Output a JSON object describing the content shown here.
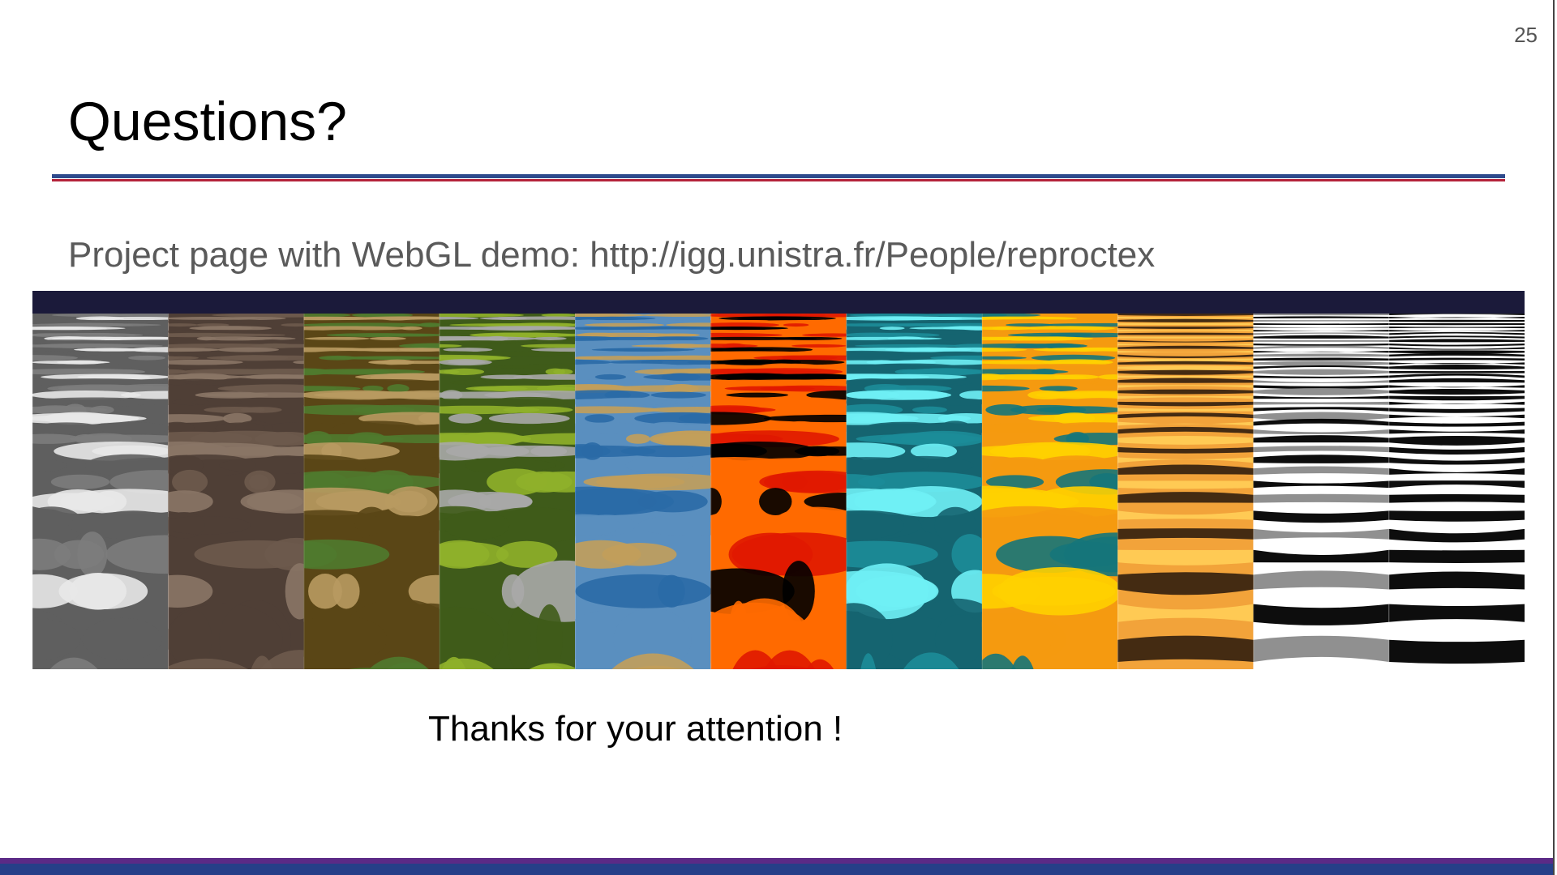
{
  "slide": {
    "page_number": "25",
    "title": "Questions?",
    "subtitle": "Project page with WebGL demo: http://igg.unistra.fr/People/reproctex",
    "closing": "Thanks for your attention !"
  },
  "colors": {
    "title_rule_blue": "#2e4a8c",
    "title_rule_red": "#b4233a",
    "footer_purple": "#5b2a86",
    "footer_blue": "#263f88",
    "strip_sky": "#1b1a3a"
  },
  "texture_panels": [
    {
      "name": "texture-panel-gray-water",
      "base": "#5f5f5f",
      "mid": "#7c7c7c",
      "light": "#e8e8e8"
    },
    {
      "name": "texture-panel-brown-rock",
      "base": "#4f3f36",
      "mid": "#6d5a4d",
      "light": "#8a7566"
    },
    {
      "name": "texture-panel-camouflage",
      "base": "#5a4616",
      "mid": "#4f7a2e",
      "light": "#b89a60"
    },
    {
      "name": "texture-panel-green-camo",
      "base": "#3f5b1a",
      "mid": "#8fb02a",
      "light": "#a8a8a8"
    },
    {
      "name": "texture-panel-blue-sand",
      "base": "#5a8fbf",
      "mid": "#c29e5a",
      "light": "#2a6aa6"
    },
    {
      "name": "texture-panel-lava",
      "base": "#ff6a00",
      "mid": "#e01800",
      "light": "#000000"
    },
    {
      "name": "texture-panel-teal-caustics",
      "base": "#156470",
      "mid": "#1c8c98",
      "light": "#6ff0f5"
    },
    {
      "name": "texture-panel-teal-orange",
      "base": "#f59a10",
      "mid": "#15767a",
      "light": "#ffd000"
    },
    {
      "name": "texture-panel-orange-stripes",
      "base": "#f2a33a",
      "mid": "#3a2510",
      "light": "#ffcc55"
    },
    {
      "name": "texture-panel-bw-stripes-soft",
      "base": "#ffffff",
      "mid": "#8a8a8a",
      "light": "#000000"
    },
    {
      "name": "texture-panel-bw-stripes-sharp",
      "base": "#ffffff",
      "mid": "#000000",
      "light": "#000000"
    }
  ]
}
